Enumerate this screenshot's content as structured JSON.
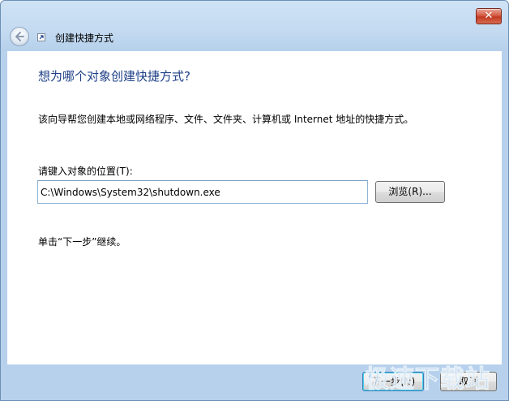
{
  "window": {
    "title": "创建快捷方式",
    "close_label": "✕"
  },
  "main": {
    "heading": "想为哪个对象创建快捷方式?",
    "description": "该向导帮您创建本地或网络程序、文件、文件夹、计算机或 Internet 地址的快捷方式。",
    "location_label": "请键入对象的位置(T):",
    "location_value": "C:\\Windows\\System32\\shutdown.exe",
    "browse_label": "浏览(R)...",
    "hint": "单击“下一步”继续。"
  },
  "footer": {
    "next_label": "下一步(N)",
    "cancel_label": "取消"
  },
  "watermark": "极速下载站",
  "colors": {
    "heading": "#1e3f87",
    "frame": "#c2d9f0",
    "close": "#c23b22"
  }
}
